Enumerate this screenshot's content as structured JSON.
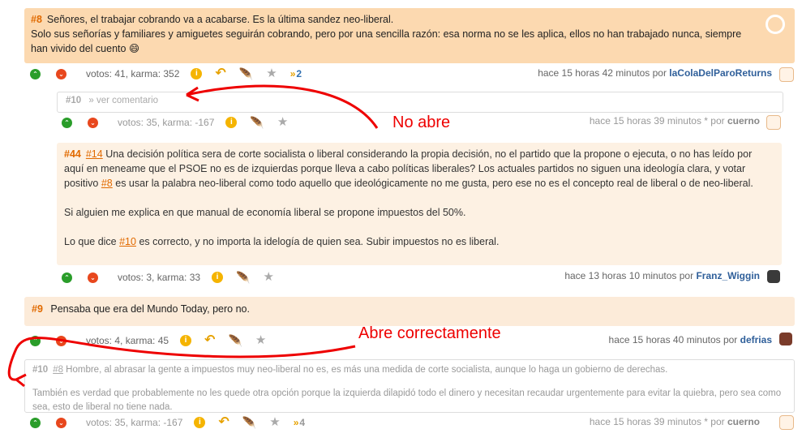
{
  "comments": {
    "c8": {
      "num": "#8",
      "line1": "Señores, el trabajar cobrando va a acabarse. Es la última sandez neo-liberal.",
      "line2": "Solo sus señorías y familiares y amiguetes seguirán cobrando, pero por una sencilla razón: esa norma no se les aplica, ellos no han trabajado nunca, siempre",
      "line3": "han vivido del cuento",
      "emoji": "😄",
      "stats": "votos: 41, karma: 352",
      "shares": "2",
      "time": "hace 15 horas 42 minutos por",
      "author": "laColaDelParoReturns"
    },
    "c10": {
      "num": "#10",
      "link": "» ver comentario",
      "stats": "votos: 35, karma: -167",
      "time": "hace 15 horas 39 minutos *  por",
      "author": "cuerno"
    },
    "c44": {
      "num": "#44",
      "ref1": "#14",
      "p1a": " Una decisión política sera de corte socialista o liberal considerando la propia decisión, no el partido que la propone o ejecuta, o no has leído por aquí en meneame que el PSOE no es de izquierdas porque lleva a cabo políticas liberales? Los actuales partidos no siguen una ideología clara, y votar positivo ",
      "ref2": "#8",
      "p1b": " es usar la palabra neo-liberal como todo aquello que ideológicamente no me gusta, pero ese no es el concepto real de liberal o de neo-liberal.",
      "p2": "Si alguien me explica en que manual de economía liberal se propone impuestos del 50%.",
      "p3a": "Lo que dice ",
      "ref3": "#10",
      "p3b": " es correcto, y no importa la idelogía de quien sea. Subir impuestos no es liberal.",
      "stats": "votos: 3, karma: 33",
      "time": "hace 13 horas 10 minutos por",
      "author": "Franz_Wiggin"
    },
    "c9": {
      "num": "#9",
      "text": "Pensaba que era del Mundo Today, pero no.",
      "stats": "votos: 4, karma: 45",
      "time": "hace 15 horas 40 minutos por",
      "author": "defrias"
    },
    "c10b": {
      "num": "#10",
      "ref": "#8",
      "p1": " Hombre, al abrasar la gente a impuestos muy neo-liberal no es, es más una medida de corte socialista, aunque lo haga un gobierno de derechas.",
      "p2": "También es verdad que probablemente no les quede otra opción porque la izquierda dilapidó todo el dinero y necesitan recaudar urgentemente para evitar la quiebra, pero sea como sea, esto de liberal no tiene nada.",
      "stats": "votos: 35, karma: -167",
      "shares": "4",
      "time": "hace 15 horas 39 minutos *  por",
      "author": "cuerno"
    }
  },
  "annotations": {
    "no_abre": "No abre",
    "abre": "Abre correctamente"
  },
  "icons": {
    "vote_up": "chevron-up-icon",
    "vote_down": "chevron-down-icon",
    "info": "info-icon",
    "reply": "reply-icon",
    "feather": "feather-icon",
    "star": "star-icon",
    "share": "share-icon"
  },
  "colors": {
    "highlight_bg": "#fcd9b0",
    "comment_bg": "#fdf1e3",
    "accent": "#e16a00",
    "author": "#2f5f9a",
    "annotation": "#e00000"
  }
}
